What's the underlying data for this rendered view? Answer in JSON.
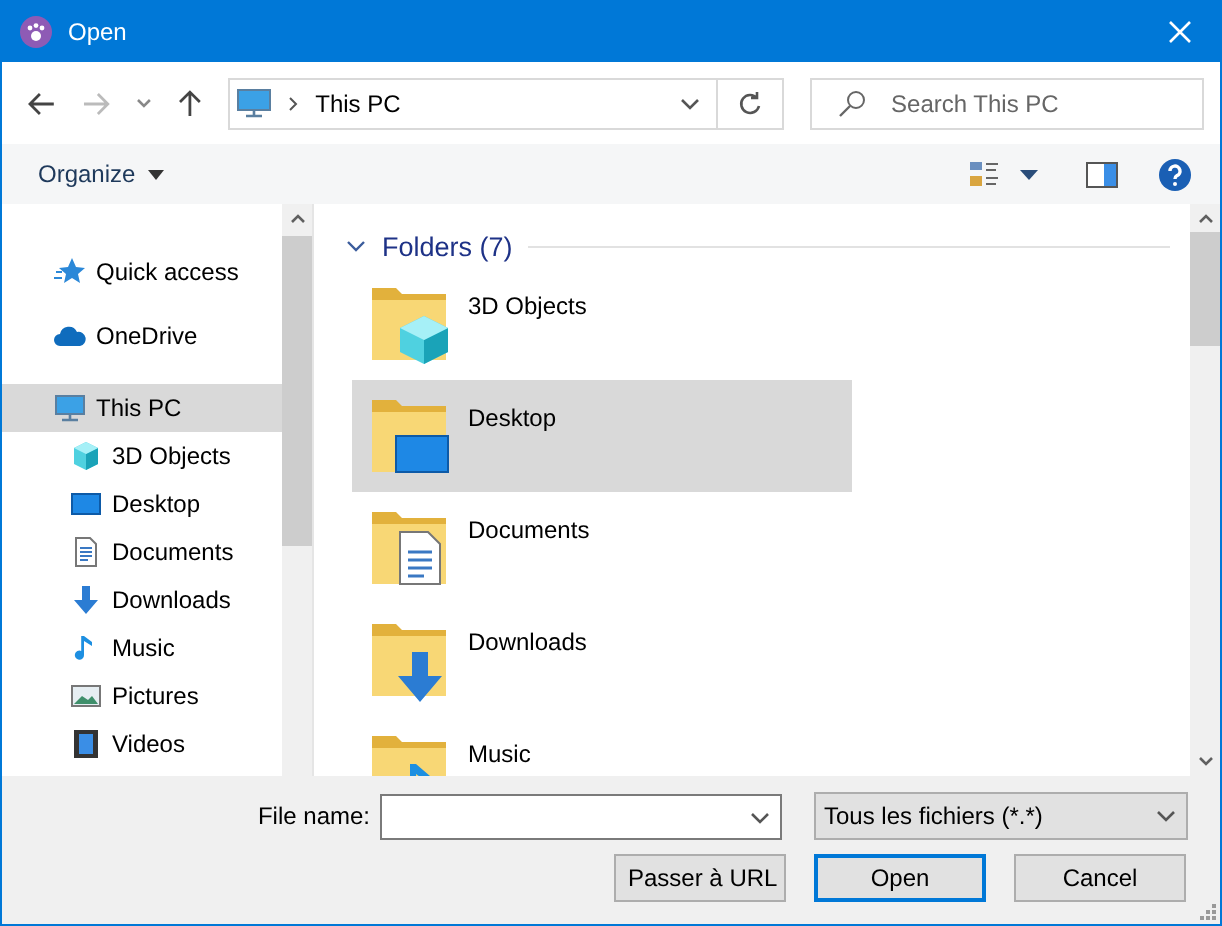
{
  "window": {
    "title": "Open"
  },
  "navigation": {
    "address": "This PC",
    "search_placeholder": "Search This PC"
  },
  "toolbar": {
    "organize": "Organize"
  },
  "sidebar": {
    "items": [
      {
        "label": "Quick access",
        "selected": false
      },
      {
        "label": "OneDrive",
        "selected": false
      },
      {
        "label": "This PC",
        "selected": true,
        "children": [
          {
            "label": "3D Objects",
            "selected": false
          },
          {
            "label": "Desktop",
            "selected": false
          },
          {
            "label": "Documents",
            "selected": false
          },
          {
            "label": "Downloads",
            "selected": false
          },
          {
            "label": "Music",
            "selected": false
          },
          {
            "label": "Pictures",
            "selected": false
          },
          {
            "label": "Videos",
            "selected": false
          }
        ]
      }
    ]
  },
  "folders": {
    "heading": "Folders (7)",
    "expanded": true,
    "items": [
      {
        "label": "3D Objects",
        "selected": false
      },
      {
        "label": "Desktop",
        "selected": true
      },
      {
        "label": "Documents",
        "selected": false
      },
      {
        "label": "Downloads",
        "selected": false
      },
      {
        "label": "Music",
        "selected": false
      }
    ]
  },
  "footer": {
    "file_name_label": "File name:",
    "file_type": "Tous les fichiers (*.*)",
    "buttons": [
      {
        "label": "Passer à URL",
        "default": false
      },
      {
        "label": "Open",
        "default": true
      },
      {
        "label": "Cancel",
        "default": false
      }
    ]
  }
}
